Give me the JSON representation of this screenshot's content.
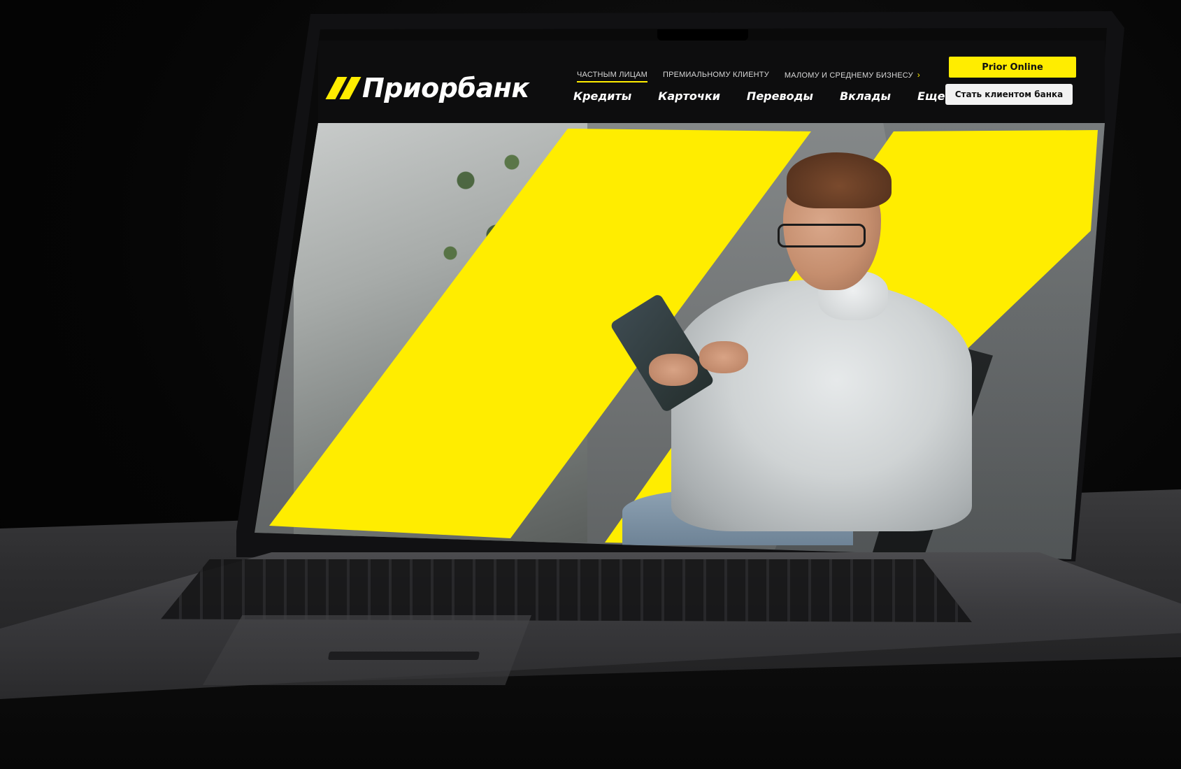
{
  "site": {
    "brand": "Приорбанк",
    "segments": [
      {
        "label": "ЧАСТНЫМ ЛИЦАМ",
        "active": true
      },
      {
        "label": "ПРЕМИАЛЬНОМУ КЛИЕНТУ",
        "active": false
      },
      {
        "label": "МАЛОМУ И СРЕДНЕМУ БИЗНЕСУ",
        "active": false
      }
    ],
    "segment_more_icon": "chevron-right-icon",
    "main_nav": [
      "Кредиты",
      "Карточки",
      "Переводы",
      "Вклады",
      "Еще"
    ],
    "buttons": {
      "prior_online": "Prior Online",
      "become_client": "Стать клиентом банка"
    }
  },
  "colors": {
    "brand_yellow": "#ffed00",
    "header_bg": "#0d0d0e",
    "nav_text": "#ffffff"
  }
}
